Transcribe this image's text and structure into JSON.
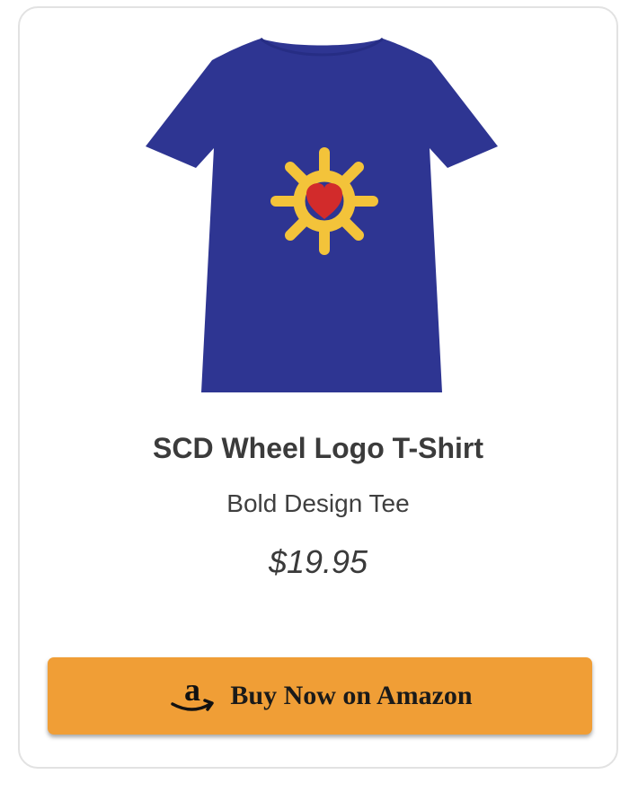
{
  "product": {
    "title": "SCD Wheel Logo T-Shirt",
    "subtitle": "Bold Design Tee",
    "price": "$19.95",
    "shirt_color": "#2e3592",
    "logo_color": "#f3c33a",
    "heart_color": "#d22b2b"
  },
  "buy_button": {
    "label": "Buy Now on Amazon",
    "icon": "amazon-logo-icon",
    "background": "#f09e36"
  }
}
